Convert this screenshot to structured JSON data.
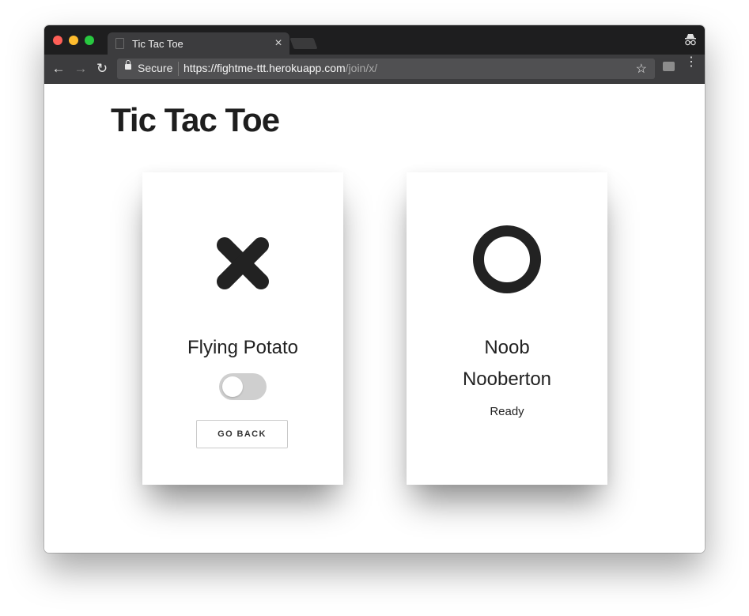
{
  "browser": {
    "tab_title": "Tic Tac Toe",
    "tab_close": "×",
    "secure_label": "Secure",
    "url_main": "https://fightme-ttt.herokuapp.com",
    "url_path": "/join/x/",
    "back": "←",
    "forward": "→",
    "reload": "↻",
    "bookmark": "☆",
    "menu": "⋮"
  },
  "page": {
    "title": "Tic Tac Toe"
  },
  "players": [
    {
      "symbol": "x-icon",
      "name": "Flying Potato",
      "toggle_on": false,
      "button_label": "GO BACK"
    },
    {
      "symbol": "o-icon",
      "name_line1": "Noob",
      "name_line2": "Nooberton",
      "status": "Ready"
    }
  ],
  "colors": {
    "symbol": "#222222",
    "toggle_off": "#cfcfcf"
  }
}
